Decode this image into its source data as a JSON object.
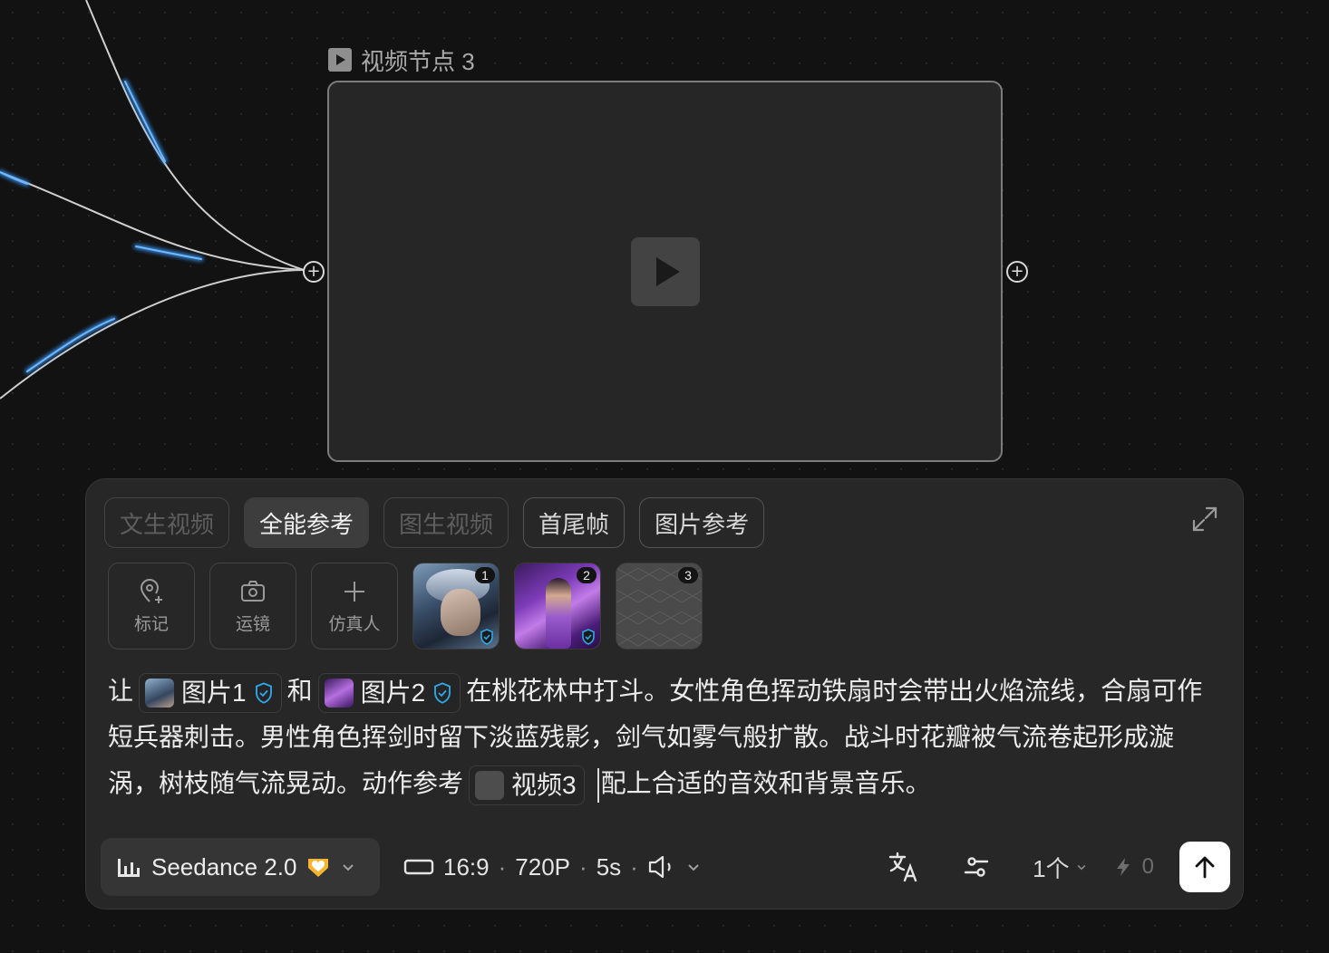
{
  "node": {
    "title": "视频节点 3",
    "icons": {
      "title": "video-node-icon",
      "play": "play-icon",
      "in_port": "plus-circle-icon",
      "out_port": "plus-circle-icon"
    }
  },
  "panel": {
    "tabs": [
      {
        "label": "文生视频",
        "state": "disabled"
      },
      {
        "label": "全能参考",
        "state": "active"
      },
      {
        "label": "图生视频",
        "state": "disabled"
      },
      {
        "label": "首尾帧",
        "state": "normal"
      },
      {
        "label": "图片参考",
        "state": "normal"
      }
    ],
    "tools": [
      {
        "label": "标记",
        "icon": "location-pin-plus-icon"
      },
      {
        "label": "运镜",
        "icon": "camera-icon"
      },
      {
        "label": "仿真人",
        "icon": "plus-icon"
      }
    ],
    "references": [
      {
        "badge": "1",
        "verified": true
      },
      {
        "badge": "2",
        "verified": true
      },
      {
        "badge": "3",
        "verified": false
      }
    ],
    "prompt": {
      "t1": "让",
      "chip1": "图片1",
      "t2": "和",
      "chip2": "图片2",
      "t3": "在桃花林中打斗。女性角色挥动铁扇时会带出火焰流线，合扇可作短兵器刺击。男性角色挥剑时留下淡蓝残影，剑气如雾气般扩散。战斗时花瓣被气流卷起形成漩涡，树枝随气流晃动。动作参考",
      "chip3": "视频3",
      "t4": "配上合适的音效和背景音乐。"
    },
    "model": {
      "name": "Seedance 2.0",
      "icon": "audio-bars-icon",
      "badge_icon": "heart-badge-icon"
    },
    "settings": {
      "ratio": "16:9",
      "resolution": "720P",
      "duration": "5s",
      "ratio_icon": "aspect-ratio-icon",
      "audio_icon": "speaker-icon"
    },
    "count": "1个",
    "credits": "0",
    "icons": {
      "translate": "translate-icon",
      "adjust": "sliders-icon",
      "credits": "bolt-icon",
      "send": "arrow-up-icon",
      "expand": "expand-icon"
    },
    "colors": {
      "accent_blue": "#3a9bff",
      "badge_gold": "#f6b52f",
      "verified": "#2ea8e8"
    }
  }
}
